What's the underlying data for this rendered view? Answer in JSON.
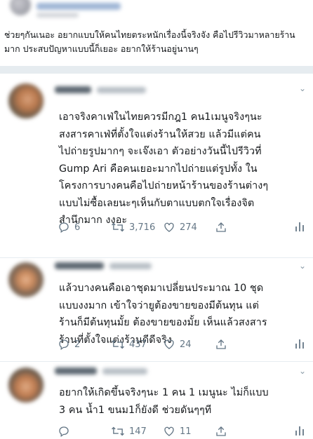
{
  "original_tweet": {
    "text": "ช่วยๆกันเนอะ อยากแบบให้คนไทยตระหนักเรื่องนี้จริงจัง คือไปรีวิวมาหลายร้านมาก ประสบปัญหาแบบนี้ก็เยอะ อยากให้ร้านอยู่นานๆ"
  },
  "replies": [
    {
      "lines": [
        "เอาจริงคาเฟ่ในไทยควรมีกฎ1 คน1เมนูจริงๆนะ",
        "สงสารคาเฟ่ที่ตั้งใจแต่งร้านให้สวย แล้วมีแต่คน",
        "ไปถ่ายรูปมากๆ จะเจ๊งเอา ตัวอย่างวันนี้ไปรีวิวที่",
        "Gump Ari คือคนเยอะมากไปถ่ายแต่รูปทั้ง ใน",
        "โครงการบางคนคือไปถ่ายหน้าร้านของร้านต่างๆ",
        "แบบไม่ซื้อเลยนะๆเห็นกับตาแบบตกใจเรื่องจิต",
        "สำนึกมาก งงอะ"
      ],
      "replies_count": "6",
      "retweets_count": "3,716",
      "likes_count": "274"
    },
    {
      "lines": [
        "แล้วบางคนคือเอาชุดมาเปลี่ยนประมาณ 10 ชุด",
        "แบบงงมาก เข้าใจว่ายูต้องขายของมีต้นทุน แต่",
        "ร้านก็มีต้นทุนมั้ย ต้องขายของมั้ย เห็นแล้วสงสาร",
        "ร้านที่ตั้งใจแต่งร้านดีดีจริง"
      ],
      "replies_count": "2",
      "retweets_count": "437",
      "likes_count": "24"
    },
    {
      "lines": [
        "อยากให้เกิดขึ้นจริงๆนะ 1 คน 1 เมนูนะ ไม่ก็แบบ",
        "3 คน น้ำ1 ขนม1ก็ยังดี ช่วยดันๆๆที"
      ],
      "replies_count": "",
      "retweets_count": "147",
      "likes_count": "11"
    }
  ],
  "icons": {
    "reply": "reply-icon",
    "retweet": "retweet-icon",
    "like": "heart-icon",
    "share": "share-icon",
    "stats": "stats-icon",
    "caret": "chevron-down-icon"
  },
  "colors": {
    "text": "#14171a",
    "muted": "#657786",
    "separator": "#e6ecf0"
  }
}
